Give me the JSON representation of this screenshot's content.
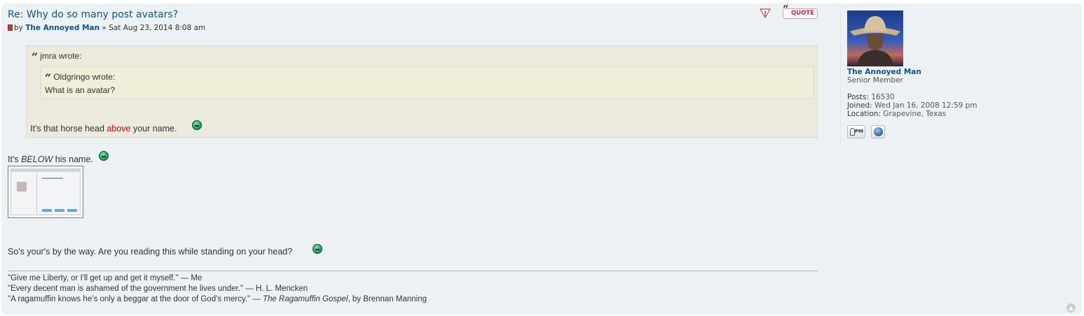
{
  "post": {
    "title": "Re: Why do so many post avatars?",
    "meta_by": "by",
    "author": "The Annoyed Man",
    "meta_rest": "» Sat Aug 23, 2014 8:08 am",
    "quote_label": "QUOTE",
    "outer_quote": {
      "cite": "jmra wrote:",
      "inner_quote": {
        "cite": "Oldgringo wrote:",
        "text": "What is an avatar?"
      },
      "reply_before": "It's that horse head ",
      "reply_highlight": "above",
      "reply_after": " your name."
    },
    "line1_before": "It's ",
    "line1_em": "BELOW",
    "line1_after": " his name.",
    "line2": "So's your's by the way. Are you reading this while standing on your head?",
    "signature": {
      "line1": "\"Give me Liberty, or I'll get up and get it myself.\" — Me",
      "line2": "\"Every decent man is ashamed of the government he lives under.\" — H. L. Mencken",
      "line3_before": "\"A ragamuffin knows he’s only a beggar at the door of God’s mercy.\" — ",
      "line3_em": "The Ragamuffin Gospel",
      "line3_after": ", by Brennan Manning"
    }
  },
  "profile": {
    "name": "The Annoyed Man",
    "rank": "Senior Member",
    "posts_label": "Posts:",
    "posts_value": "16530",
    "joined_label": "Joined:",
    "joined_value": "Wed Jan 16, 2008 12:59 pm",
    "location_label": "Location:",
    "location_value": "Grapevine, Texas",
    "pm_label": "PM"
  },
  "icons": {
    "report": "report-icon",
    "quote": "quote-icon",
    "post": "post-icon",
    "smiley": "smiley-icon",
    "grin": "grin-icon",
    "pm": "pm-icon",
    "website": "globe-icon",
    "top": "back-to-top-icon"
  },
  "colors": {
    "post_bg": "#ecf1f3",
    "link": "#105289",
    "quote_bg": "#ebeadd",
    "nested_quote_bg": "#efeed9",
    "highlight": "#cc0000"
  }
}
